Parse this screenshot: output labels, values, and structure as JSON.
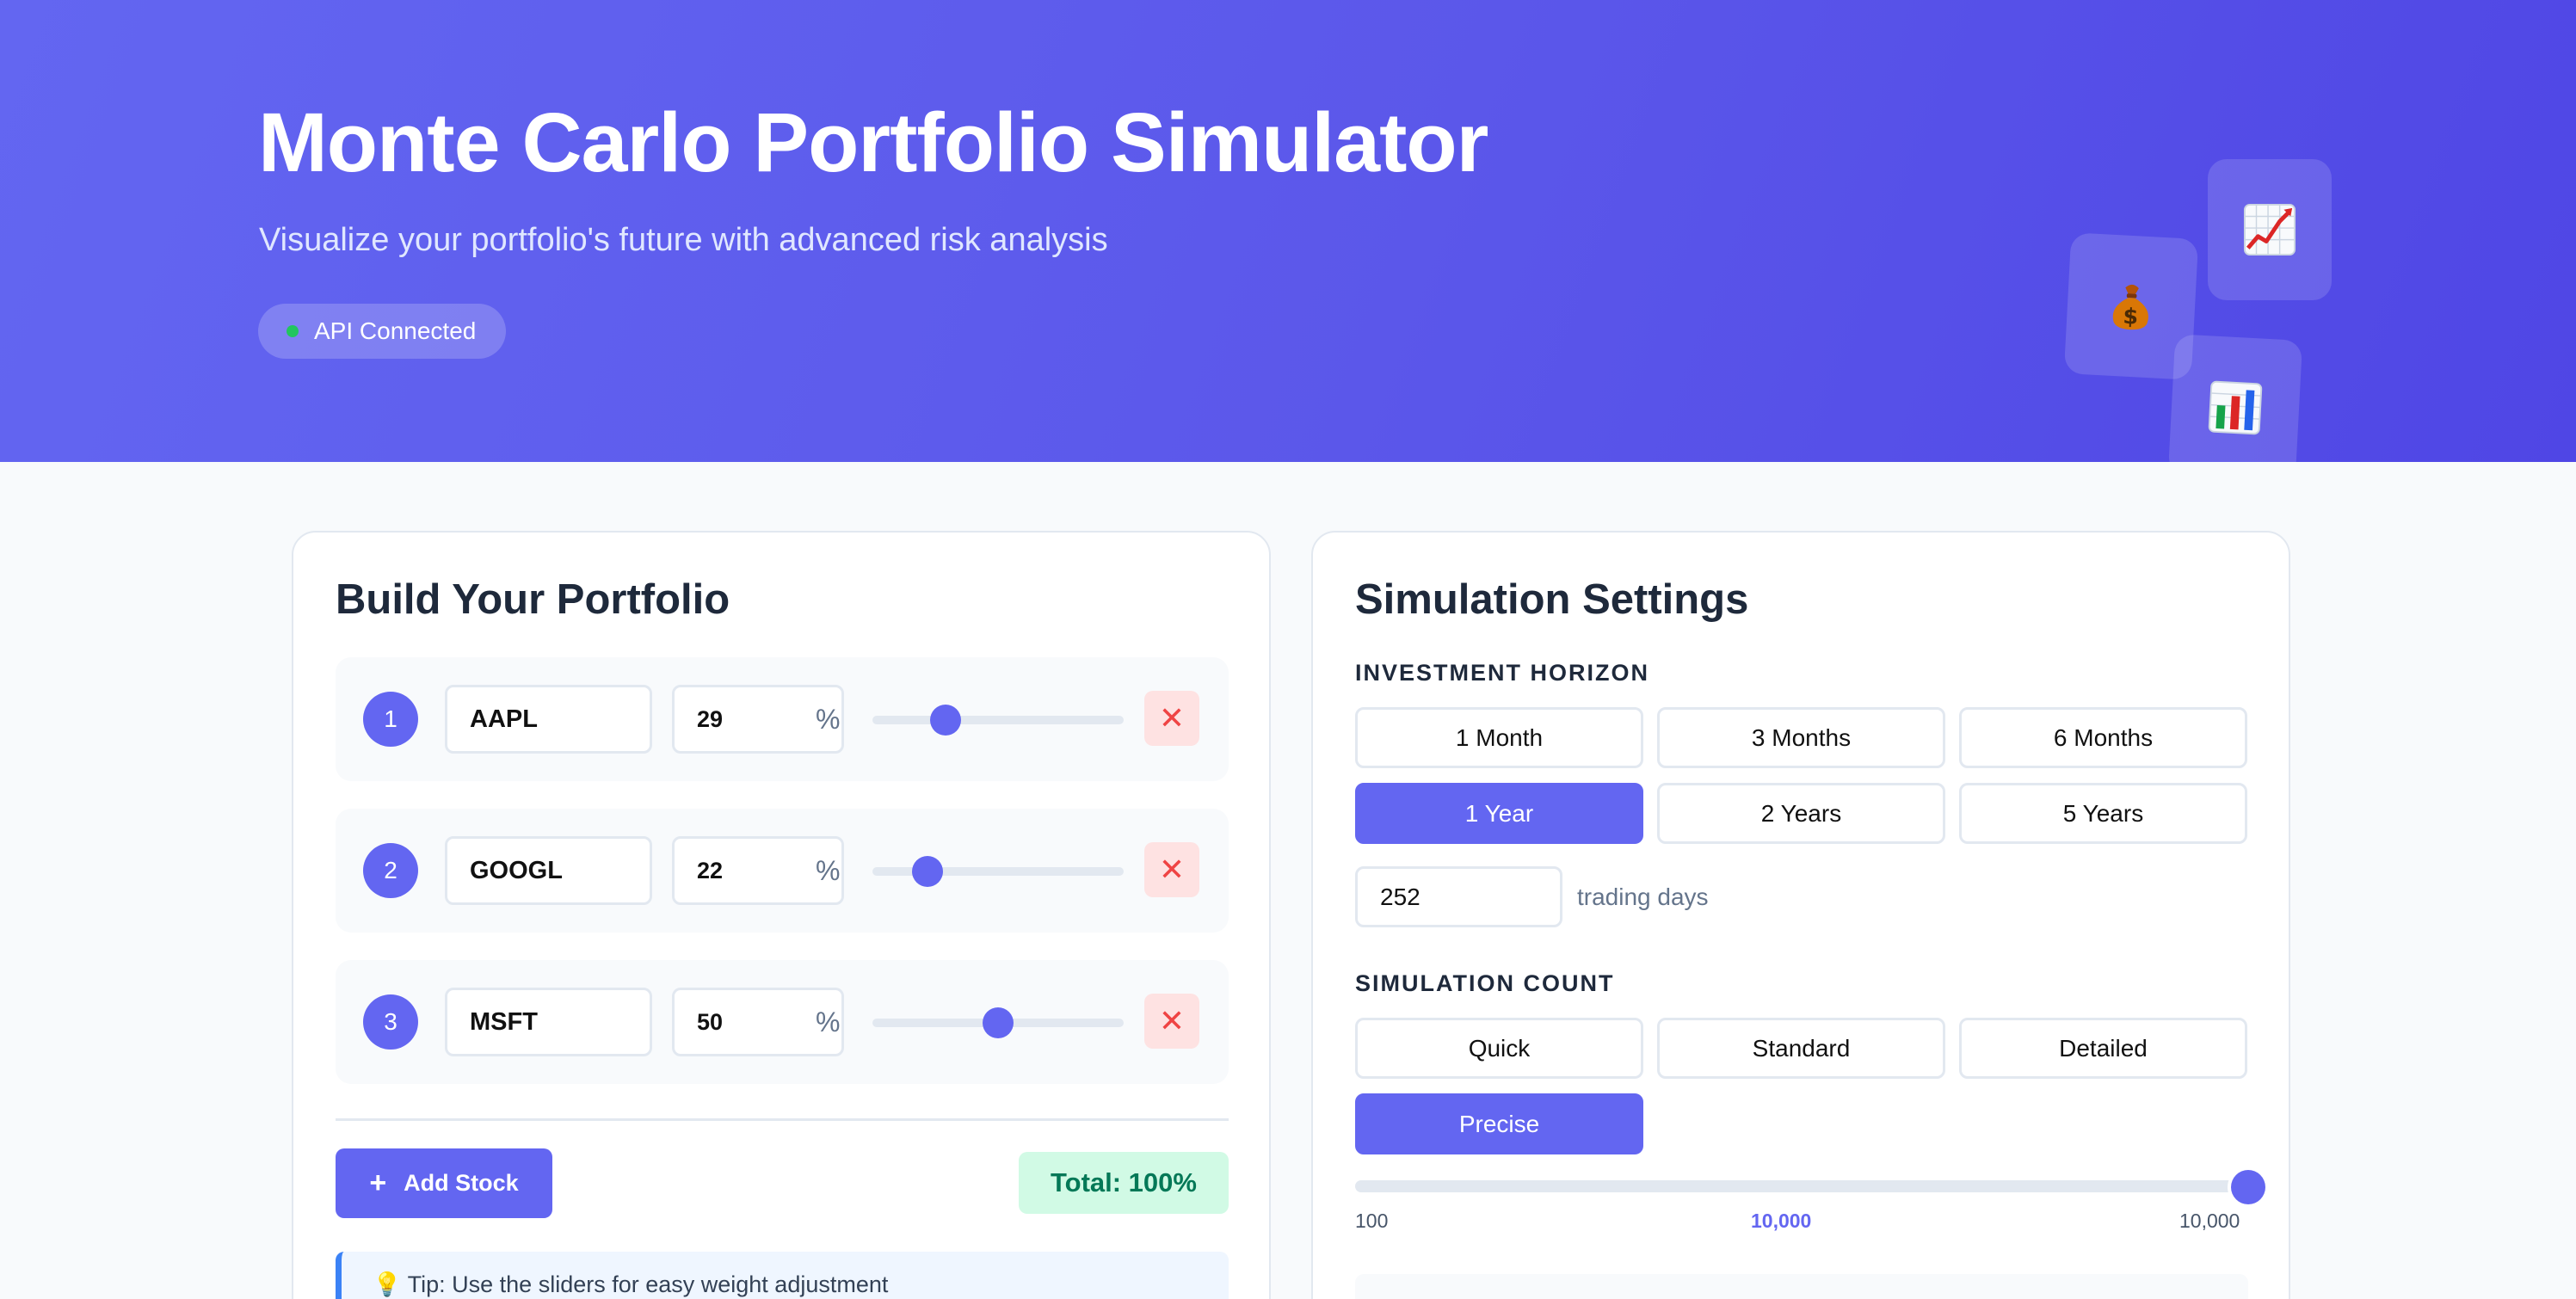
{
  "header": {
    "title": "Monte Carlo Portfolio Simulator",
    "subtitle": "Visualize your portfolio's future with advanced risk analysis",
    "api_status": "API Connected",
    "float_icons": [
      {
        "name": "chart-increasing-icon",
        "glyph": "📈"
      },
      {
        "name": "money-bag-icon",
        "glyph": "💰"
      },
      {
        "name": "bar-chart-icon",
        "glyph": "📊"
      }
    ]
  },
  "portfolio": {
    "title": "Build Your Portfolio",
    "stocks": [
      {
        "index": "1",
        "ticker": "AAPL",
        "weight": "29",
        "unit": "%",
        "slider_fraction": 0.29
      },
      {
        "index": "2",
        "ticker": "GOOGL",
        "weight": "22",
        "unit": "%",
        "slider_fraction": 0.22
      },
      {
        "index": "3",
        "ticker": "MSFT",
        "weight": "50",
        "unit": "%",
        "slider_fraction": 0.5
      }
    ],
    "add_label": "Add Stock",
    "total_label": "Total: 100%",
    "tip": "💡 Tip: Use the sliders for easy weight adjustment"
  },
  "settings": {
    "title": "Simulation Settings",
    "horizon_label": "INVESTMENT HORIZON",
    "horizon_options": [
      "1 Month",
      "3 Months",
      "6 Months",
      "1 Year",
      "2 Years",
      "5 Years"
    ],
    "horizon_selected": "1 Year",
    "trading_days_value": "252",
    "trading_days_label": "trading days",
    "count_label": "SIMULATION COUNT",
    "count_options": [
      "Quick",
      "Standard",
      "Detailed",
      "Precise"
    ],
    "count_selected": "Precise",
    "count_min": "100",
    "count_current": "10,000",
    "count_max": "10,000",
    "count_fraction": 1.0
  },
  "colors": {
    "accent": "#6366f1",
    "success_bg": "#d1fae5",
    "success_text": "#047857",
    "danger_bg": "#fee2e2",
    "danger_text": "#ef4444",
    "status_dot": "#22c55e"
  }
}
